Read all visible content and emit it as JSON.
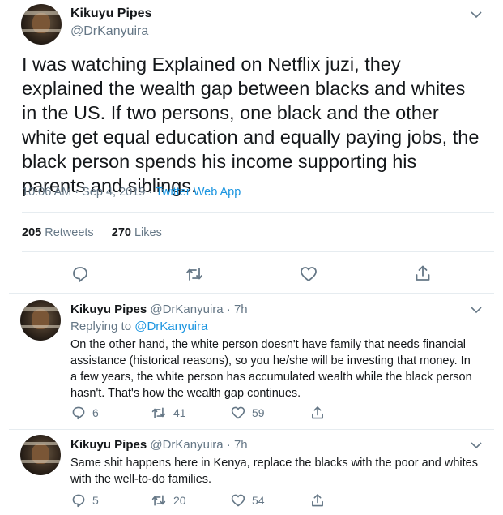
{
  "main_tweet": {
    "name": "Kikuyu Pipes",
    "handle": "@DrKanyuira",
    "text": "I was watching Explained on Netflix juzi, they explained the wealth gap between blacks and whites in the US.  If two persons, one black and the other white get equal education and equally paying jobs, the black person spends his income supporting his parents and siblings.",
    "timestamp": "10:06 AM · Sep 4, 2019 · ",
    "source": "Twitter Web App",
    "retweets_count": "205",
    "retweets_label": " Retweets",
    "likes_count": "270",
    "likes_label": " Likes"
  },
  "replies": [
    {
      "name": "Kikuyu Pipes",
      "handle_time": " @DrKanyuira · 7h",
      "replying_prefix": "Replying to ",
      "replying_to": "@DrKanyuira",
      "text": "On the other hand,  the white person doesn't have family that needs financial assistance (historical reasons), so you he/she will be investing that money. In a few years, the white person has accumulated wealth while the black person hasn't. That's how the wealth gap continues.",
      "reply_count": "6",
      "retweet_count": "41",
      "like_count": "59"
    },
    {
      "name": "Kikuyu Pipes",
      "handle_time": " @DrKanyuira · 7h",
      "text": "Same shit happens here in Kenya, replace the blacks with the poor and whites with the well-to-do families.",
      "reply_count": "5",
      "retweet_count": "20",
      "like_count": "54"
    }
  ],
  "icons": {
    "reply": "reply-icon",
    "retweet": "retweet-icon",
    "like": "heart-icon",
    "share": "share-icon",
    "more": "chevron-down-icon"
  },
  "colors": {
    "text": "#14171a",
    "secondary": "#657786",
    "link": "#1b95e0",
    "divider": "#e6ecf0"
  }
}
